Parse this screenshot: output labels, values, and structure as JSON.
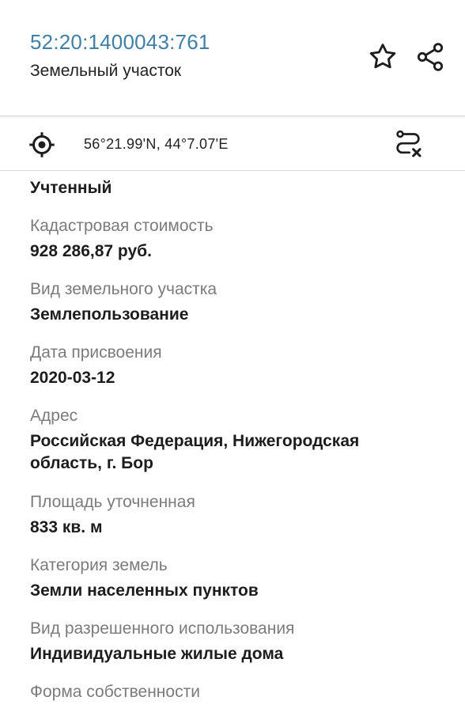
{
  "header": {
    "cadastral_number": "52:20:1400043:761",
    "object_type": "Земельный участок",
    "icons": {
      "favorite": "star-icon",
      "share": "share-icon"
    }
  },
  "coordbar": {
    "coordinates": "56°21.99'N, 44°7.07'E",
    "icons": {
      "locate": "crosshair-icon",
      "route": "route-clear-icon"
    }
  },
  "details": {
    "status_value": "Учтенный",
    "fields": [
      {
        "label": "Кадастровая стоимость",
        "value": "928 286,87 руб."
      },
      {
        "label": "Вид земельного участка",
        "value": "Землепользование"
      },
      {
        "label": "Дата присвоения",
        "value": "2020-03-12"
      },
      {
        "label": "Адрес",
        "value_line1": "Российская Федерация, Нижегородская",
        "value_line2": "область, г. Бор"
      },
      {
        "label": "Площадь уточненная",
        "value": "833 кв. м"
      },
      {
        "label": "Категория земель",
        "value": "Земли населенных пунктов"
      },
      {
        "label": "Вид разрешенного использования",
        "value": "Индивидуальные жилые дома"
      },
      {
        "label": "Форма собственности"
      }
    ]
  },
  "colors": {
    "accent": "#3f7fa8",
    "label": "#7b7b7b",
    "text": "#1d1d1f",
    "divider": "#d8d8d8"
  }
}
